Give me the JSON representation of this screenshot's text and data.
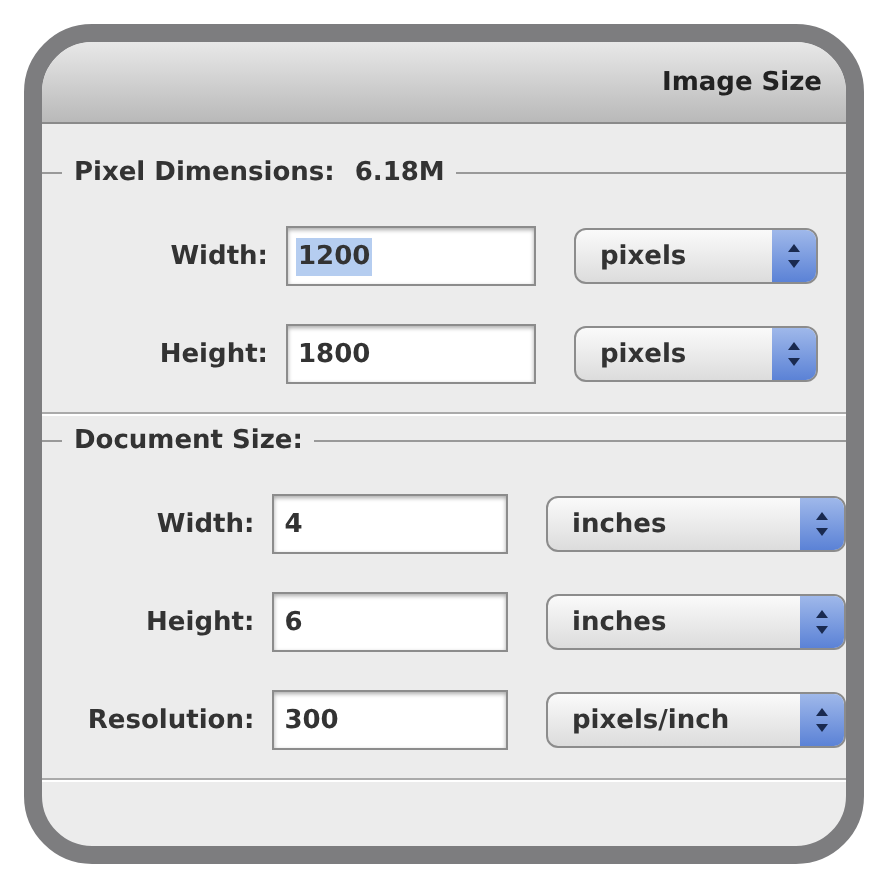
{
  "window": {
    "title": "Image Size"
  },
  "sections": [
    {
      "legend": "Pixel Dimensions:",
      "value": "6.18M",
      "rows": [
        {
          "label": "Width:",
          "value": "1200",
          "selected": true,
          "unit": "pixels"
        },
        {
          "label": "Height:",
          "value": "1800",
          "selected": false,
          "unit": "pixels"
        }
      ]
    },
    {
      "legend": "Document Size:",
      "rows": [
        {
          "label": "Width:",
          "value": "4",
          "selected": false,
          "unit": "inches"
        },
        {
          "label": "Height:",
          "value": "6",
          "selected": false,
          "unit": "inches"
        },
        {
          "label": "Resolution:",
          "value": "300",
          "selected": false,
          "unit": "pixels/inch"
        }
      ]
    }
  ]
}
